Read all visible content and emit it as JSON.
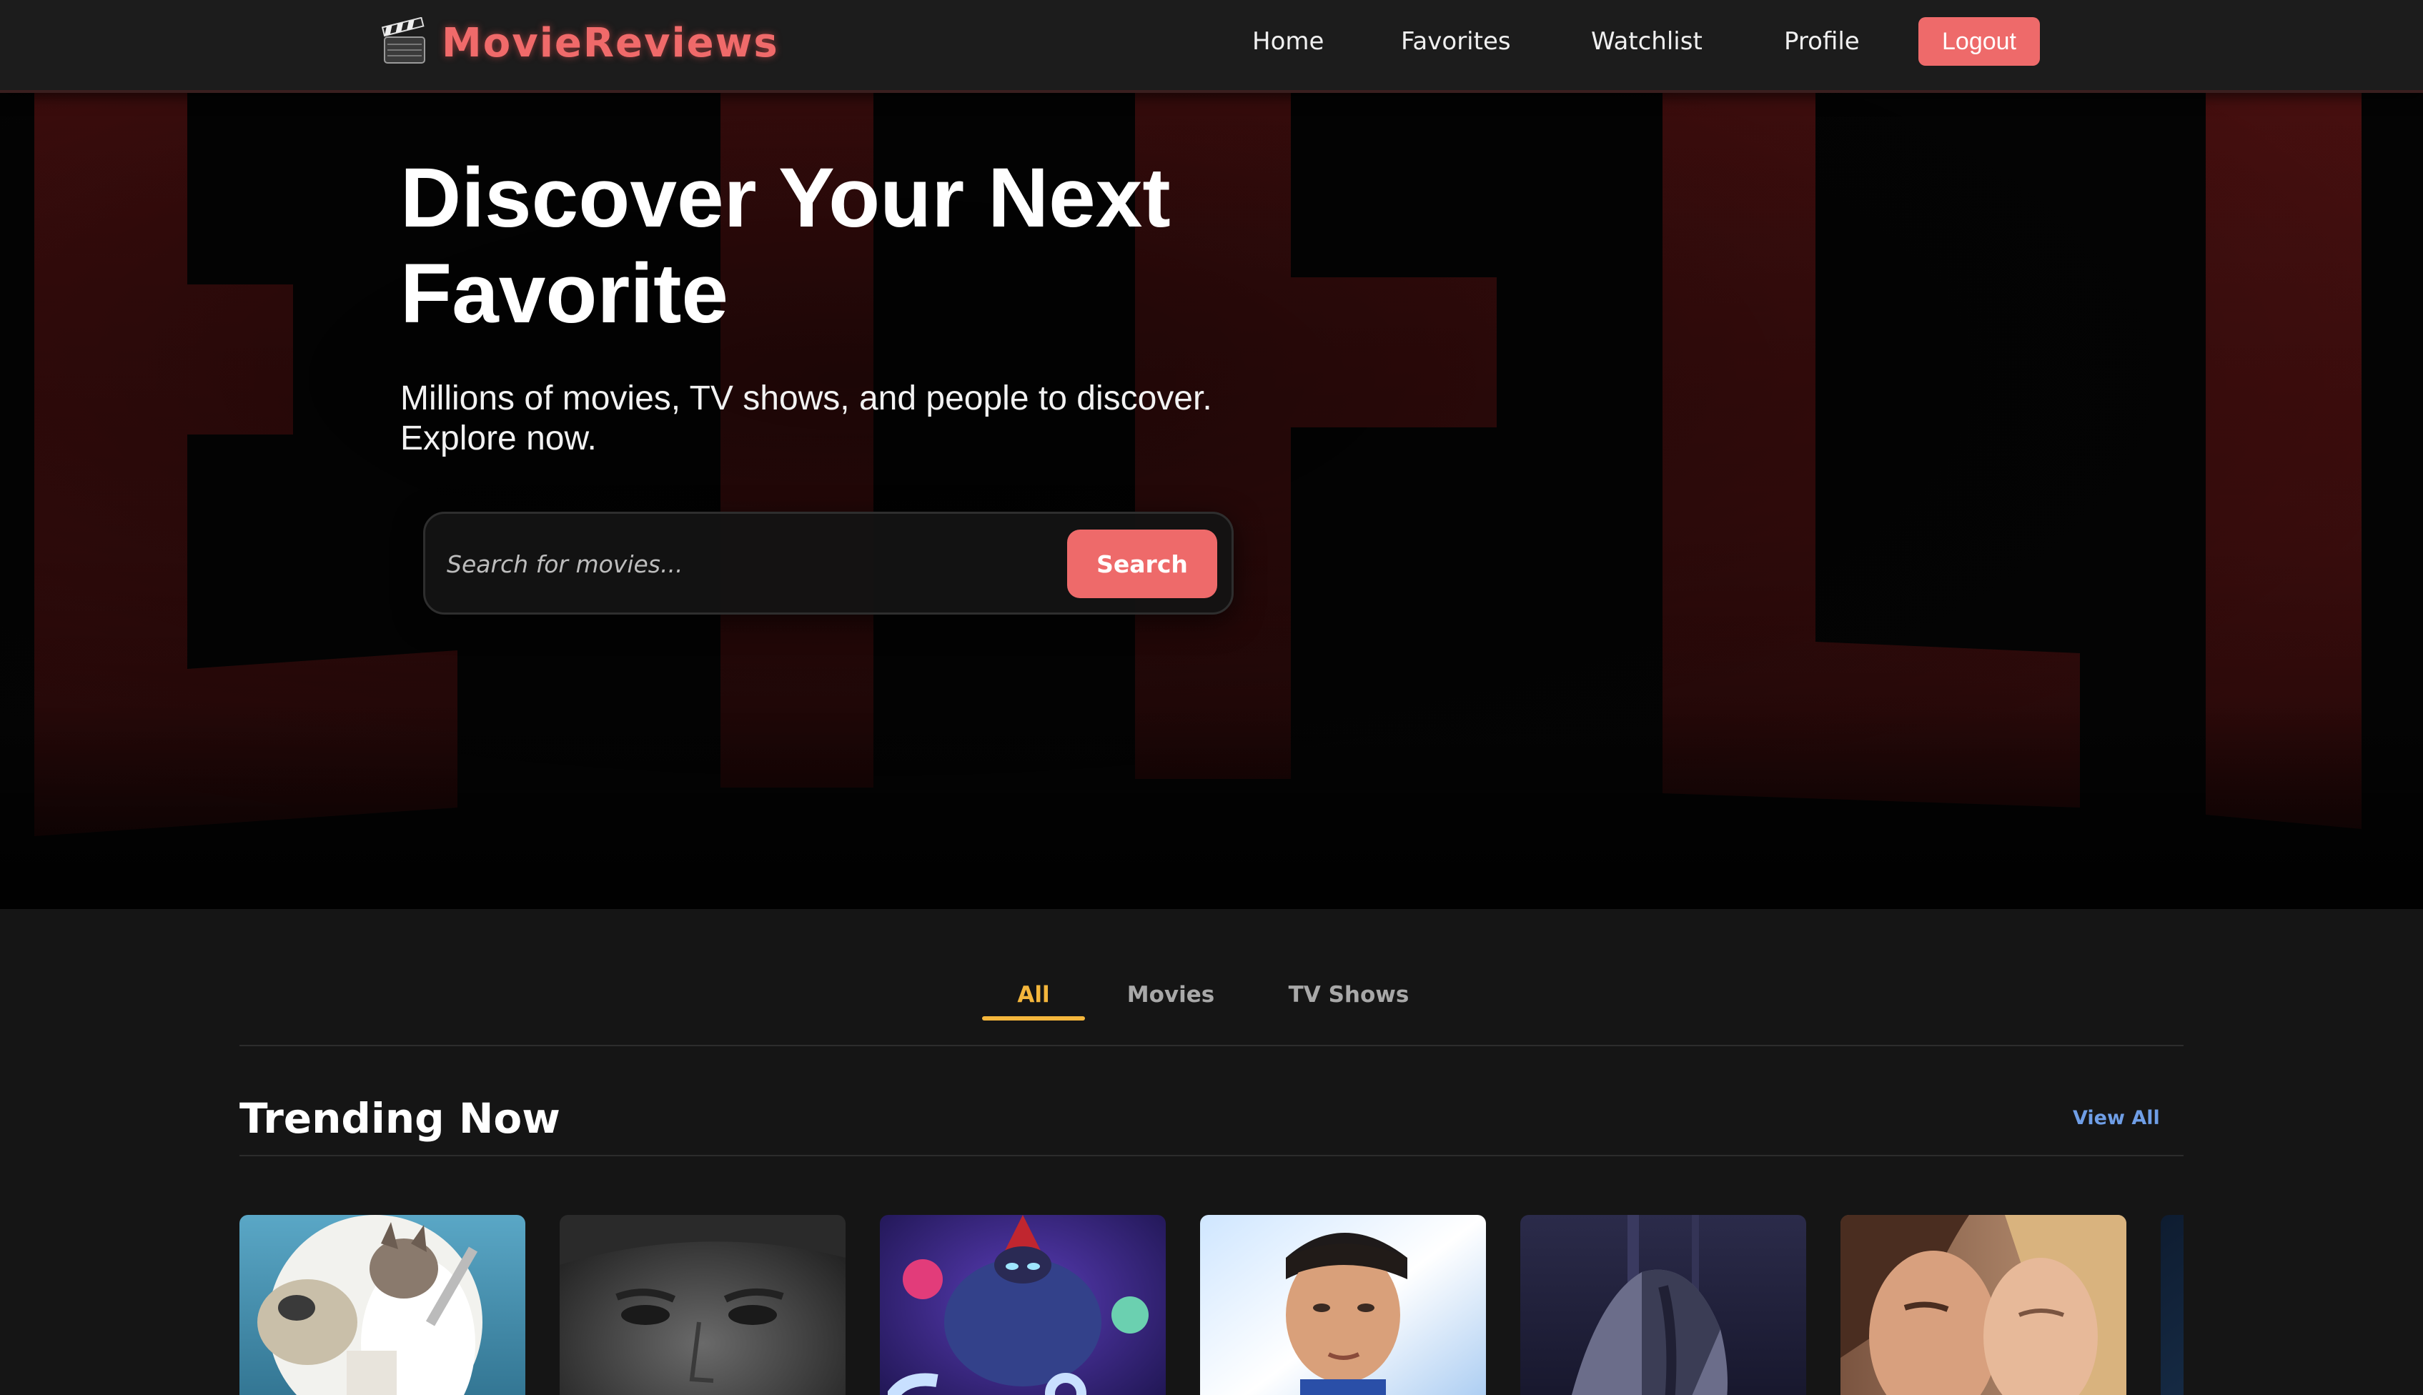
{
  "navbar": {
    "brand_icon": "clapperboard-icon",
    "brand_name": "MovieReviews",
    "links": [
      "Home",
      "Favorites",
      "Watchlist",
      "Profile"
    ],
    "logout_label": "Logout"
  },
  "hero": {
    "title_line1": "Discover Your Next",
    "title_line2": "Favorite",
    "subtitle": "Millions of movies, TV shows, and people to discover. Explore now.",
    "search_placeholder": "Search for movies...",
    "search_button": "Search"
  },
  "tabs": {
    "items": [
      "All",
      "Movies",
      "TV Shows"
    ],
    "active": "All"
  },
  "trending": {
    "title": "Trending Now",
    "view_all": "View All",
    "posters": [
      "animated-wolf-poster",
      "man-portrait-poster",
      "animated-monster-poster",
      "superhero-poster",
      "dark-figure-poster",
      "couple-romance-poster",
      "dark-blue-poster"
    ]
  },
  "colors": {
    "accent": "#ee6a6a",
    "tab_active": "#f4b63c",
    "link_blue": "#6f9ee6",
    "background": "#151515",
    "hero_red": "#5a1414"
  }
}
